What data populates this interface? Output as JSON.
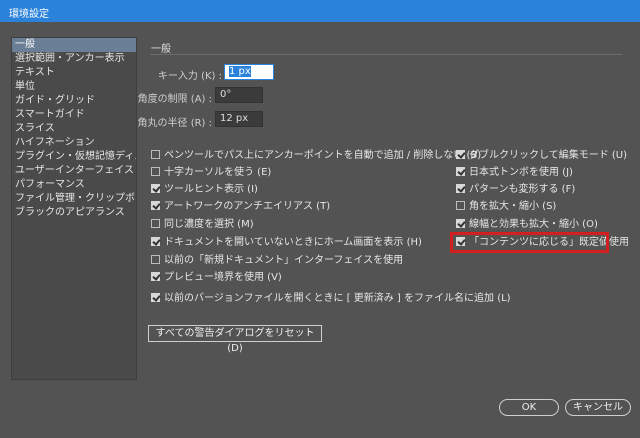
{
  "window": {
    "title": "環境設定"
  },
  "sidebar": {
    "items": [
      {
        "label": "一般"
      },
      {
        "label": "選択範囲・アンカー表示"
      },
      {
        "label": "テキスト"
      },
      {
        "label": "単位"
      },
      {
        "label": "ガイド・グリッド"
      },
      {
        "label": "スマートガイド"
      },
      {
        "label": "スライス"
      },
      {
        "label": "ハイフネーション"
      },
      {
        "label": "プラグイン・仮想記憶ディスク"
      },
      {
        "label": "ユーザーインターフェイス"
      },
      {
        "label": "パフォーマンス"
      },
      {
        "label": "ファイル管理・クリップボード"
      },
      {
        "label": "ブラックのアピアランス"
      }
    ],
    "selected": "一般"
  },
  "section": {
    "title": "一般"
  },
  "fields": {
    "key_input": {
      "label": "キー入力 (K) :",
      "value": "1 px"
    },
    "constrain_angle": {
      "label": "角度の制限 (A) :",
      "value": "0°"
    },
    "corner_radius": {
      "label": "角丸の半径 (R) :",
      "value": "12 px"
    }
  },
  "checkboxes_left": [
    {
      "label": "ペンツールでパス上にアンカーポイントを自動で追加 / 削除しない (B)",
      "checked": false
    },
    {
      "label": "十字カーソルを使う (E)",
      "checked": false
    },
    {
      "label": "ツールヒント表示 (I)",
      "checked": true
    },
    {
      "label": "アートワークのアンチエイリアス (T)",
      "checked": true
    },
    {
      "label": "同じ濃度を選択 (M)",
      "checked": false
    },
    {
      "label": "ドキュメントを開いていないときにホーム画面を表示 (H)",
      "checked": true
    },
    {
      "label": "以前の「新規ドキュメント」インターフェイスを使用",
      "checked": false
    },
    {
      "label": "プレビュー境界を使用 (V)",
      "checked": true
    },
    {
      "label": "以前のバージョンファイルを開くときに [ 更新済み ] をファイル名に追加 (L)",
      "checked": true
    }
  ],
  "checkboxes_right": [
    {
      "label": "ダブルクリックして編集モード (U)",
      "checked": true
    },
    {
      "label": "日本式トンボを使用 (J)",
      "checked": true
    },
    {
      "label": "パターンも変形する (F)",
      "checked": true
    },
    {
      "label": "角を拡大・縮小 (S)",
      "checked": false
    },
    {
      "label": "線幅と効果も拡大・縮小 (O)",
      "checked": true
    },
    {
      "label": "「コンテンツに応じる」既定値使用",
      "checked": true
    }
  ],
  "buttons": {
    "reset_warnings": "すべての警告ダイアログをリセット (D)",
    "ok": "OK",
    "cancel": "キャンセル"
  },
  "colors": {
    "titlebar": "#2a82da",
    "background": "#535353",
    "sidebar_selected": "#6a7e95",
    "highlight_box": "#d21f1f"
  }
}
